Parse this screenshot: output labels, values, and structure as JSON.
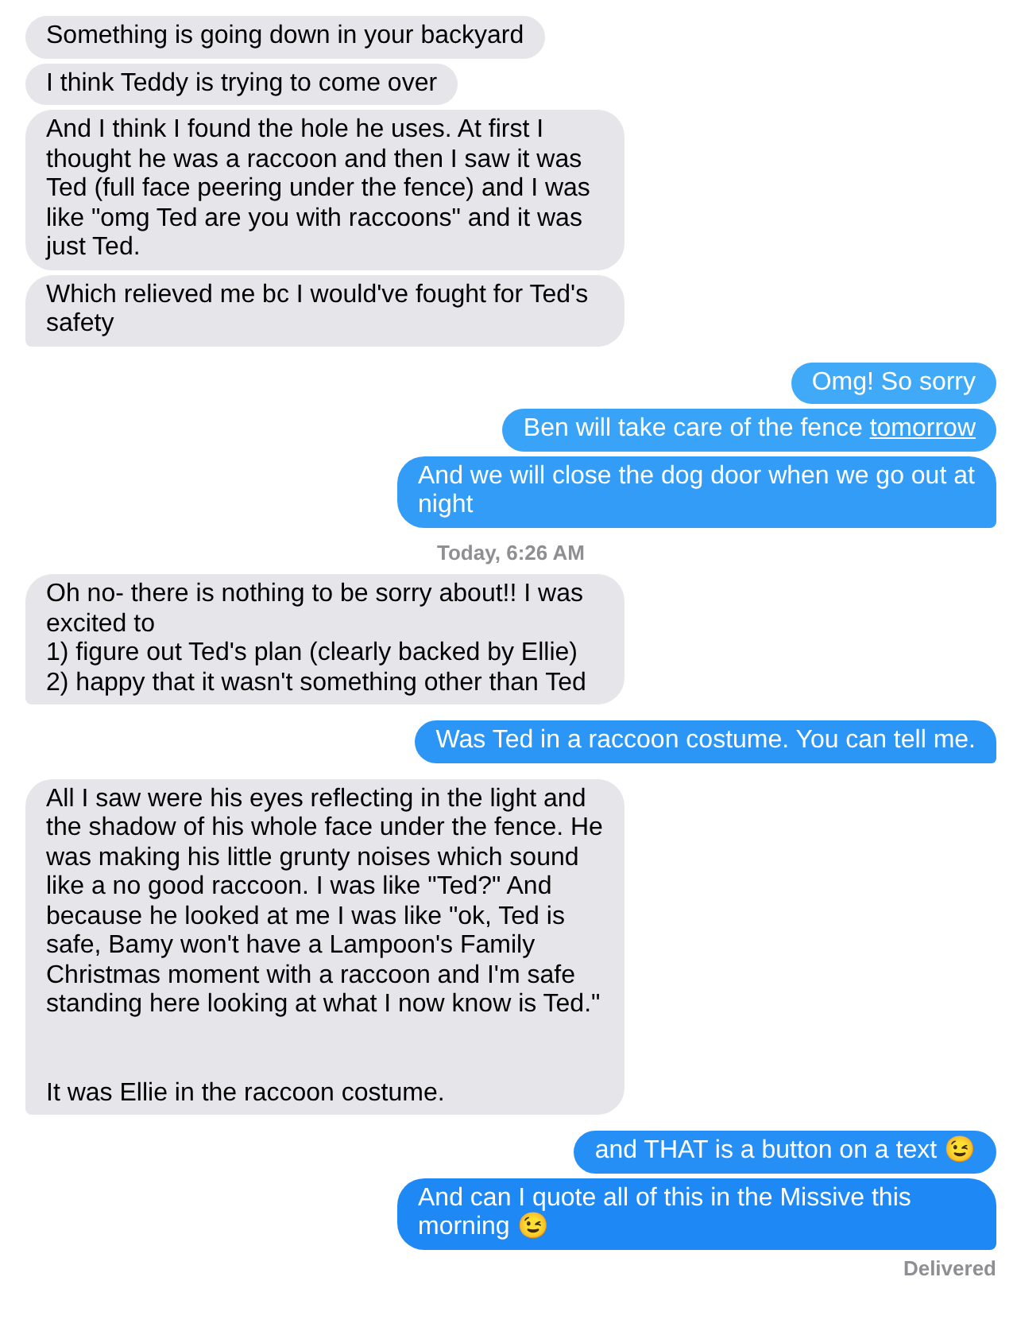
{
  "messages": [
    {
      "kind": "received",
      "text": "Something is going down in your backyard"
    },
    {
      "kind": "received",
      "text": "I think Teddy is trying to come over"
    },
    {
      "kind": "received",
      "text": "And I think I found the hole he uses. At first I thought he was a raccoon and then I saw it was Ted (full face peering under the fence) and I was like \"omg Ted are you with raccoons\" and it was just Ted."
    },
    {
      "kind": "received",
      "text": "Which relieved me bc I would've fought for Ted's safety"
    },
    {
      "kind": "sent",
      "text": "Omg! So sorry"
    },
    {
      "kind": "sent",
      "text": "Ben will take care of the fence ",
      "link": "tomorrow"
    },
    {
      "kind": "sent",
      "text": "And we will close the dog door when we go out at night"
    },
    {
      "kind": "timestamp",
      "text": "Today, 6:26 AM"
    },
    {
      "kind": "received",
      "text": "Oh no- there is nothing to be sorry about!! I was excited to\n1) figure out Ted's plan (clearly backed by Ellie)\n2) happy that it wasn't something other than Ted"
    },
    {
      "kind": "sent",
      "text": "Was Ted in a raccoon costume. You can tell me."
    },
    {
      "kind": "received",
      "text": "All I saw were his eyes reflecting in the light and the shadow of his whole face under the fence. He was making his little grunty noises which sound like a no good raccoon. I was like \"Ted?\" And because he looked at me I was like \"ok, Ted is safe, Bamy won't have a Lampoon's Family Christmas moment with a raccoon and I'm safe standing here looking at what I now know is Ted.\"\n\n\nIt was Ellie in the raccoon costume."
    },
    {
      "kind": "sent",
      "text": "and THAT is a button on a text 😉"
    },
    {
      "kind": "sent",
      "text": "And can I quote all of this in the Missive this morning 😉"
    },
    {
      "kind": "status",
      "text": "Delivered"
    }
  ]
}
